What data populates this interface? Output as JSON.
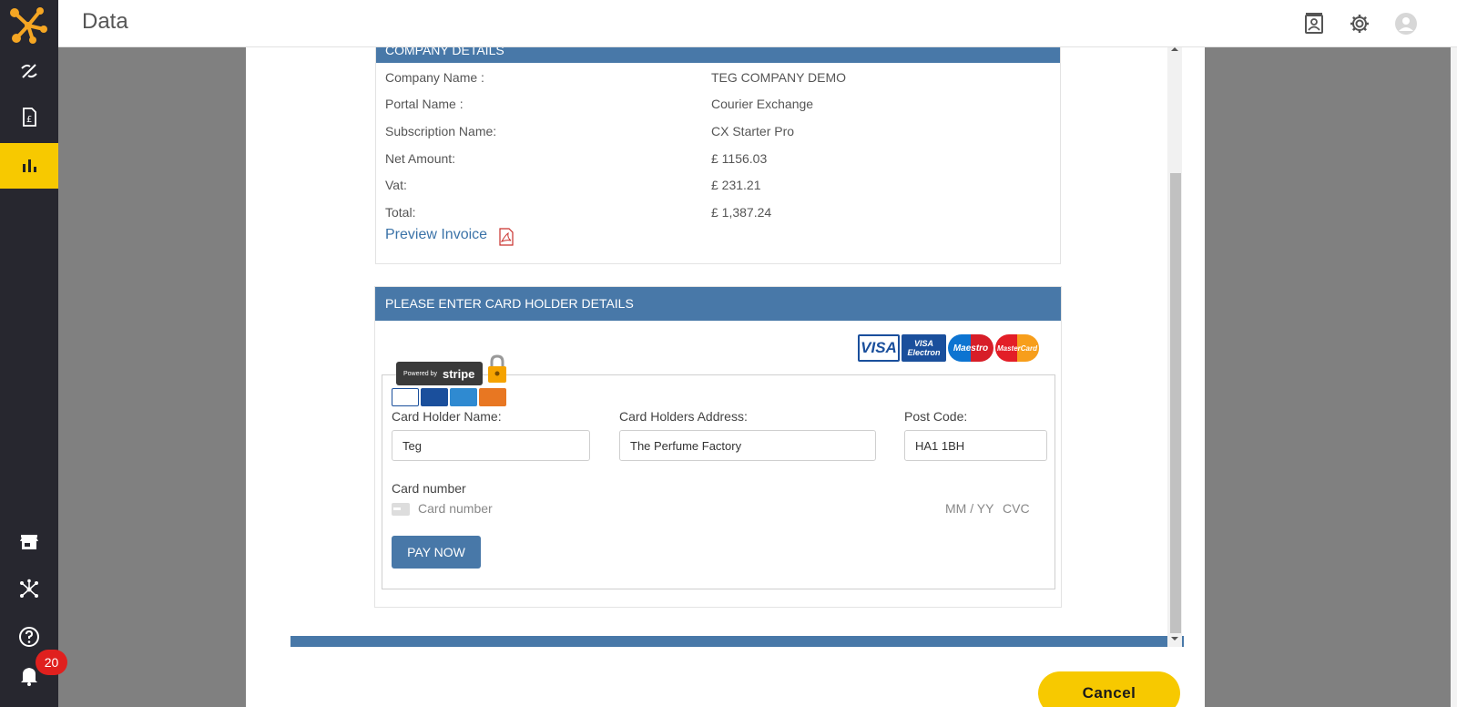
{
  "app": {
    "title": "Data",
    "notification_count": "20"
  },
  "sidebar": {
    "items": [
      {
        "name": "routes",
        "icon": "route-icon"
      },
      {
        "name": "invoices",
        "icon": "invoice-icon"
      },
      {
        "name": "data",
        "icon": "bar-chart-icon",
        "active": true
      },
      {
        "name": "store",
        "icon": "store-icon"
      },
      {
        "name": "network",
        "icon": "network-icon"
      },
      {
        "name": "help",
        "icon": "help-icon"
      },
      {
        "name": "notifications",
        "icon": "bell-icon"
      }
    ]
  },
  "header_icons": [
    "contact-card-icon",
    "gear-icon",
    "user-avatar-icon"
  ],
  "company_details": {
    "heading": "COMPANY DETAILS",
    "rows": [
      {
        "label": "Company Name :",
        "value": "TEG COMPANY DEMO"
      },
      {
        "label": "Portal Name :",
        "value": "Courier Exchange"
      },
      {
        "label": "Subscription Name:",
        "value": "CX Starter Pro"
      },
      {
        "label": "Net Amount:",
        "value": "£ 1156.03"
      },
      {
        "label": "Vat:",
        "value": "£ 231.21"
      },
      {
        "label": "Total:",
        "value": "£ 1,387.24"
      }
    ],
    "preview_link": "Preview Invoice"
  },
  "card_holder": {
    "heading": "PLEASE ENTER CARD HOLDER DETAILS",
    "brand_logos": [
      "VISA",
      "VISA Electron",
      "Maestro",
      "MasterCard"
    ],
    "stripe_badge": {
      "prefix": "Powered by",
      "brand": "stripe"
    },
    "fields": {
      "name_label": "Card Holder Name:",
      "name_value": "Teg",
      "address_label": "Card Holders Address:",
      "address_value": "The Perfume Factory",
      "postcode_label": "Post Code:",
      "postcode_value": "HA1 1BH"
    },
    "card_number_label": "Card number",
    "card_number_placeholder": "Card number",
    "expiry_placeholder": "MM / YY",
    "cvc_placeholder": "CVC",
    "pay_button": "PAY NOW"
  },
  "cancel_button": "Cancel",
  "colors": {
    "accent": "#f7c900",
    "panel_blue": "#4878a8",
    "rail": "#27272f",
    "badge": "#e0201e"
  }
}
